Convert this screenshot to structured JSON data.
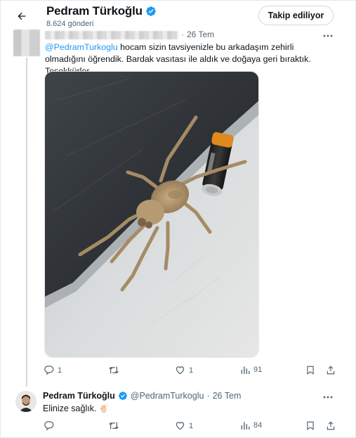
{
  "header": {
    "name": "Pedram Türkoğlu",
    "post_count": "8.624 gönderi",
    "follow_label": "Takip ediliyor"
  },
  "reply_tweet": {
    "date": "26 Tem",
    "dot": "·",
    "mention": "@PedramTurkoglu",
    "text": " hocam sizin tavsiyenizle bu arkadaşım zehirli olmadığını öğrendik. Bardak vasıtası ile aldık ve doğaya geri bıraktık. Teşekkürler",
    "stats": {
      "replies": "1",
      "retweets": "",
      "likes": "1",
      "views": "91"
    }
  },
  "author_reply": {
    "name": "Pedram Türkoğlu",
    "handle": "@PedramTurkoglu",
    "dot": "·",
    "date": "26 Tem",
    "text": "Elinize sağlık.",
    "stats": {
      "replies": "",
      "retweets": "",
      "likes": "1",
      "views": "84"
    }
  },
  "colors": {
    "verified": "#1d9bf0",
    "mention": "#1d9bf0",
    "secondary_text": "#536471",
    "border": "#cfd9de"
  },
  "icons": {
    "back": "arrow-left-icon",
    "verified": "verified-badge-icon",
    "more": "more-horizontal-icon",
    "reply": "reply-icon",
    "retweet": "retweet-icon",
    "like": "heart-icon",
    "views": "views-icon",
    "bookmark": "bookmark-icon",
    "share": "share-icon",
    "emoji": "clapping-hands-emoji"
  }
}
